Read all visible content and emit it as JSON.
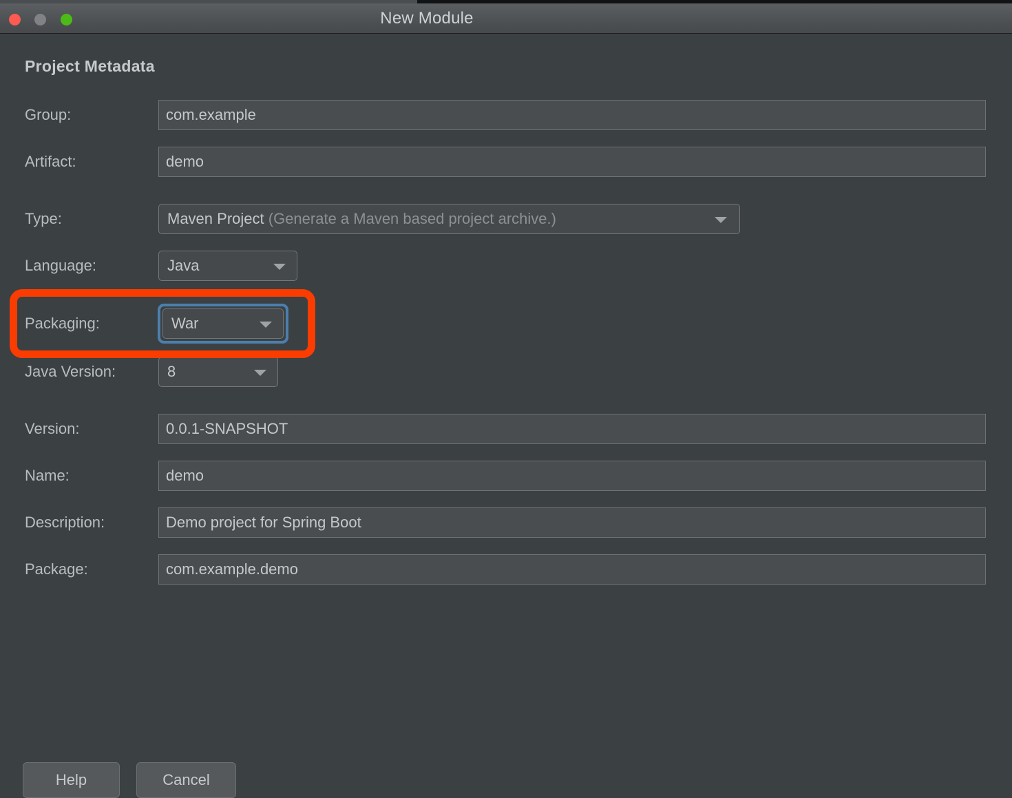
{
  "window": {
    "title": "New Module",
    "controls": {
      "close": "close-button",
      "minimize": "minimize-button",
      "maximize": "maximize-button"
    }
  },
  "section": {
    "title": "Project Metadata"
  },
  "fields": {
    "group": {
      "label": "Group:",
      "value": "com.example"
    },
    "artifact": {
      "label": "Artifact:",
      "value": "demo"
    },
    "type": {
      "label": "Type:",
      "value": "Maven Project",
      "hint": "(Generate a Maven based project archive.)"
    },
    "language": {
      "label": "Language:",
      "value": "Java"
    },
    "packaging": {
      "label": "Packaging:",
      "value": "War"
    },
    "java_version": {
      "label": "Java Version:",
      "value": "8"
    },
    "version": {
      "label": "Version:",
      "value": "0.0.1-SNAPSHOT"
    },
    "name": {
      "label": "Name:",
      "value": "demo"
    },
    "description": {
      "label": "Description:",
      "value": "Demo project for Spring Boot"
    },
    "package": {
      "label": "Package:",
      "value": "com.example.demo"
    }
  },
  "footer": {
    "help": "Help",
    "cancel": "Cancel"
  },
  "colors": {
    "annotation": "#fb3c00",
    "focus_ring": "#4c7fad",
    "dialog_bg": "#3b4043",
    "field_bg": "#494d4f",
    "traffic_close": "#fd5a51",
    "traffic_minimize": "#808285",
    "traffic_maximize": "#4cbb17"
  }
}
